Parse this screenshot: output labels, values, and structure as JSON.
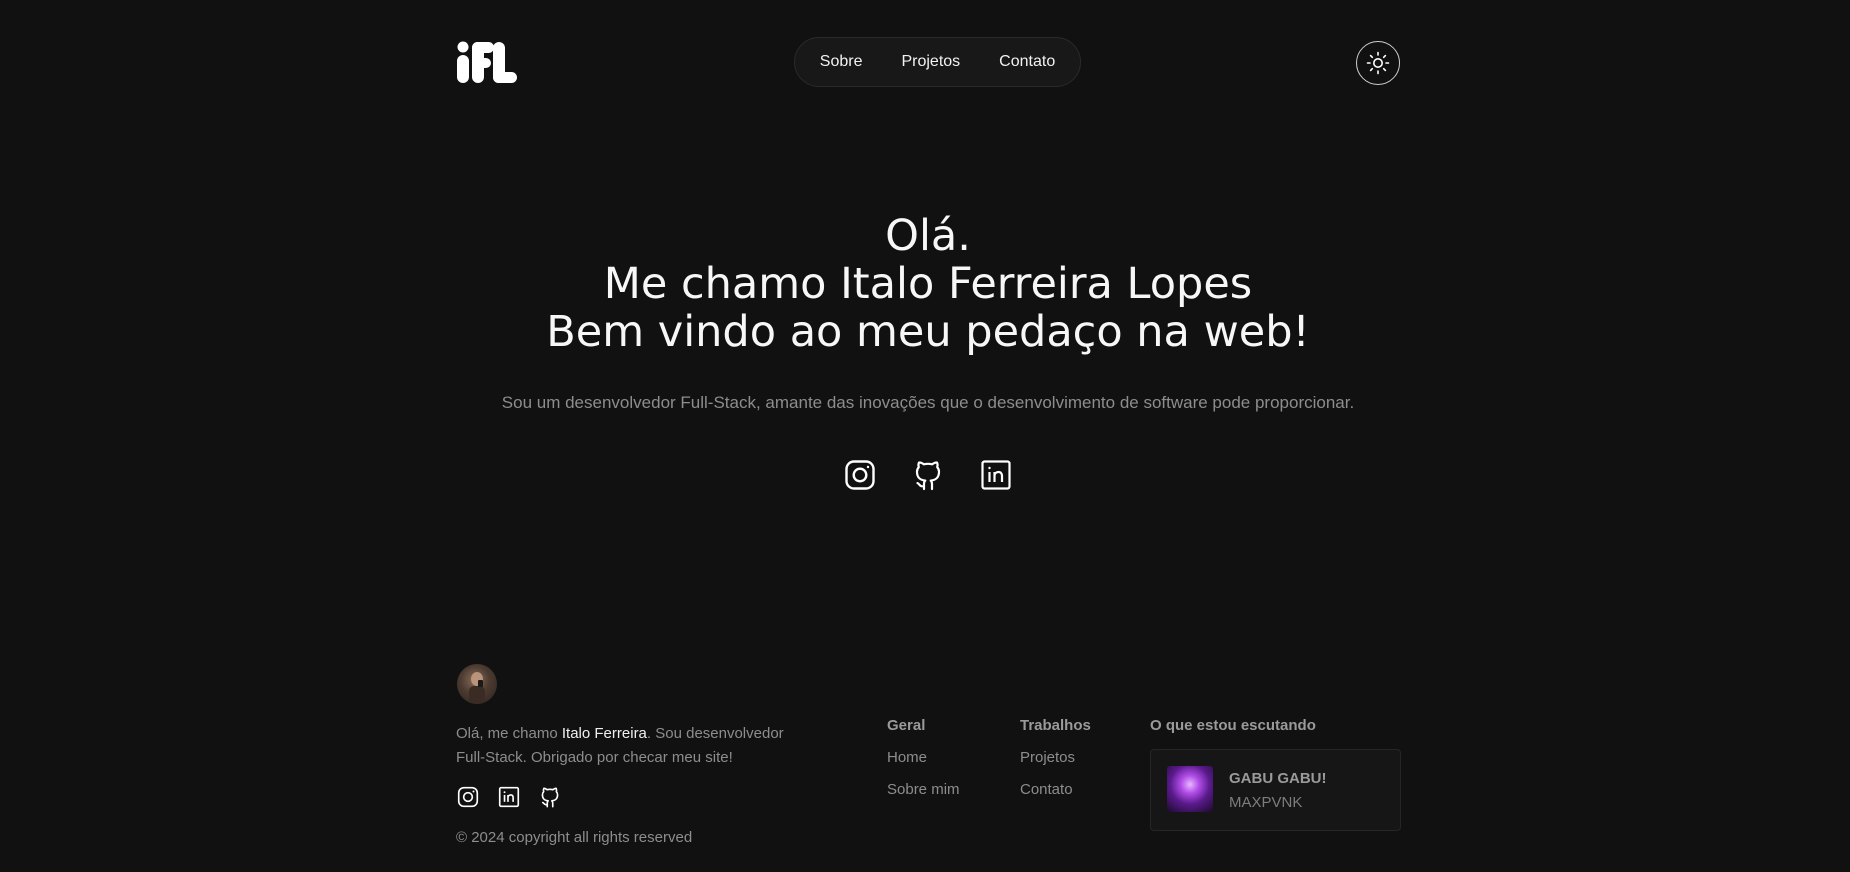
{
  "header": {
    "logo_text": "iFL",
    "nav": [
      {
        "label": "Sobre"
      },
      {
        "label": "Projetos"
      },
      {
        "label": "Contato"
      }
    ],
    "theme_icon": "sun-icon"
  },
  "hero": {
    "line1": "Olá.",
    "line2": "Me chamo Italo Ferreira Lopes",
    "line3": "Bem vindo ao meu pedaço na web!",
    "subtitle": "Sou um desenvolvedor Full-Stack, amante das inovações que o desenvolvimento de software pode proporcionar.",
    "social_icons": [
      "instagram-icon",
      "github-icon",
      "linkedin-icon"
    ]
  },
  "footer": {
    "desc_prefix": "Olá, me chamo ",
    "desc_name": "Italo Ferreira",
    "desc_suffix": ". Sou desenvolvedor Full-Stack. Obrigado por checar meu site!",
    "social_icons": [
      "instagram-icon",
      "linkedin-icon",
      "github-icon"
    ],
    "copyright": "© 2024 copyright all rights reserved",
    "geral": {
      "title": "Geral",
      "links": [
        "Home",
        "Sobre mim"
      ]
    },
    "trabalhos": {
      "title": "Trabalhos",
      "links": [
        "Projetos",
        "Contato"
      ]
    },
    "music": {
      "title": "O que estou escutando",
      "track": "GABU GABU!",
      "artist": "MAXPVNK"
    }
  },
  "colors": {
    "background": "#111111",
    "text": "#f7f7f7",
    "muted": "#8d8d8d"
  }
}
